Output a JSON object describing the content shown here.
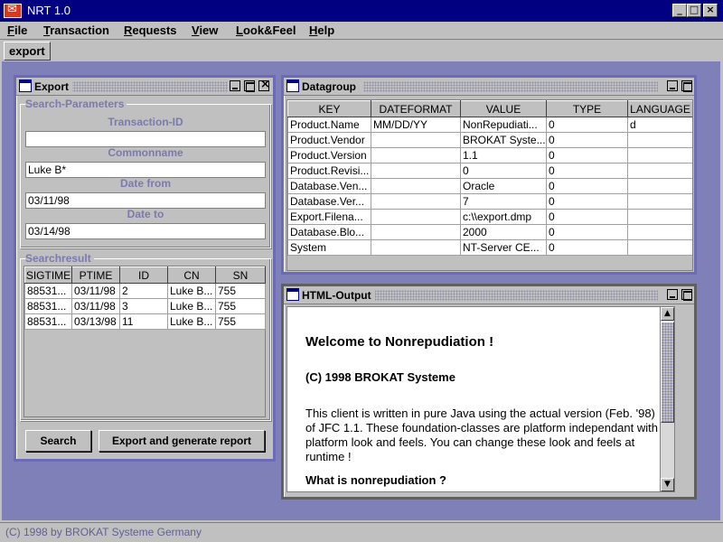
{
  "window": {
    "title": "NRT 1.0",
    "controls": [
      "_",
      "□",
      "×"
    ]
  },
  "menu": [
    "File",
    "Transaction",
    "Requests",
    "View",
    "Look&Feel",
    "Help"
  ],
  "toolbar": {
    "export_label": "export"
  },
  "export_frame": {
    "title": "Export",
    "search_parameters_label": "Search-Parameters",
    "fields": [
      {
        "label": "Transaction-ID",
        "value": ""
      },
      {
        "label": "Commonname",
        "value": "Luke B*"
      },
      {
        "label": "Date from",
        "value": "03/11/98"
      },
      {
        "label": "Date to",
        "value": "03/14/98"
      }
    ],
    "searchresult_label": "Searchresult",
    "result_columns": [
      "SIGTIME",
      "PTIME",
      "ID",
      "CN",
      "SN"
    ],
    "result_rows": [
      [
        "88531...",
        "03/11/98",
        "2",
        "Luke B...",
        "755"
      ],
      [
        "88531...",
        "03/11/98",
        "3",
        "Luke B...",
        "755"
      ],
      [
        "88531...",
        "03/13/98",
        "11",
        "Luke B...",
        "755"
      ]
    ],
    "search_button": "Search",
    "export_button": "Export and generate report"
  },
  "datagroup_frame": {
    "title": "Datagroup",
    "columns": [
      "KEY",
      "DATEFORMAT",
      "VALUE",
      "TYPE",
      "LANGUAGE"
    ],
    "rows": [
      [
        "Product.Name",
        "MM/DD/YY",
        "NonRepudiati...",
        "0",
        "d"
      ],
      [
        "Product.Vendor",
        "",
        "BROKAT Syste...",
        "0",
        ""
      ],
      [
        "Product.Version",
        "",
        "1.1",
        "0",
        ""
      ],
      [
        "Product.Revisi...",
        "",
        "0",
        "0",
        ""
      ],
      [
        "Database.Ven...",
        "",
        "Oracle",
        "0",
        ""
      ],
      [
        "Database.Ver...",
        "",
        "7",
        "0",
        ""
      ],
      [
        "Export.Filena...",
        "",
        "c:\\\\export.dmp",
        "0",
        ""
      ],
      [
        "Database.Blo...",
        "",
        "2000",
        "0",
        ""
      ],
      [
        "System",
        "",
        "NT-Server CE...",
        "0",
        ""
      ]
    ]
  },
  "html_frame": {
    "title": "HTML-Output",
    "heading": "Welcome to Nonrepudiation !",
    "copyright": "(C) 1998 BROKAT Systeme",
    "paragraph": "This client is written in pure Java using the actual version (Feb. '98) of JFC 1.1. These foundation-classes are platform independant with platform look and feels. You can change these look and feels at runtime !",
    "question": "What is nonrepudiation ?"
  },
  "status": "(C) 1998 by BROKAT Systeme Germany"
}
